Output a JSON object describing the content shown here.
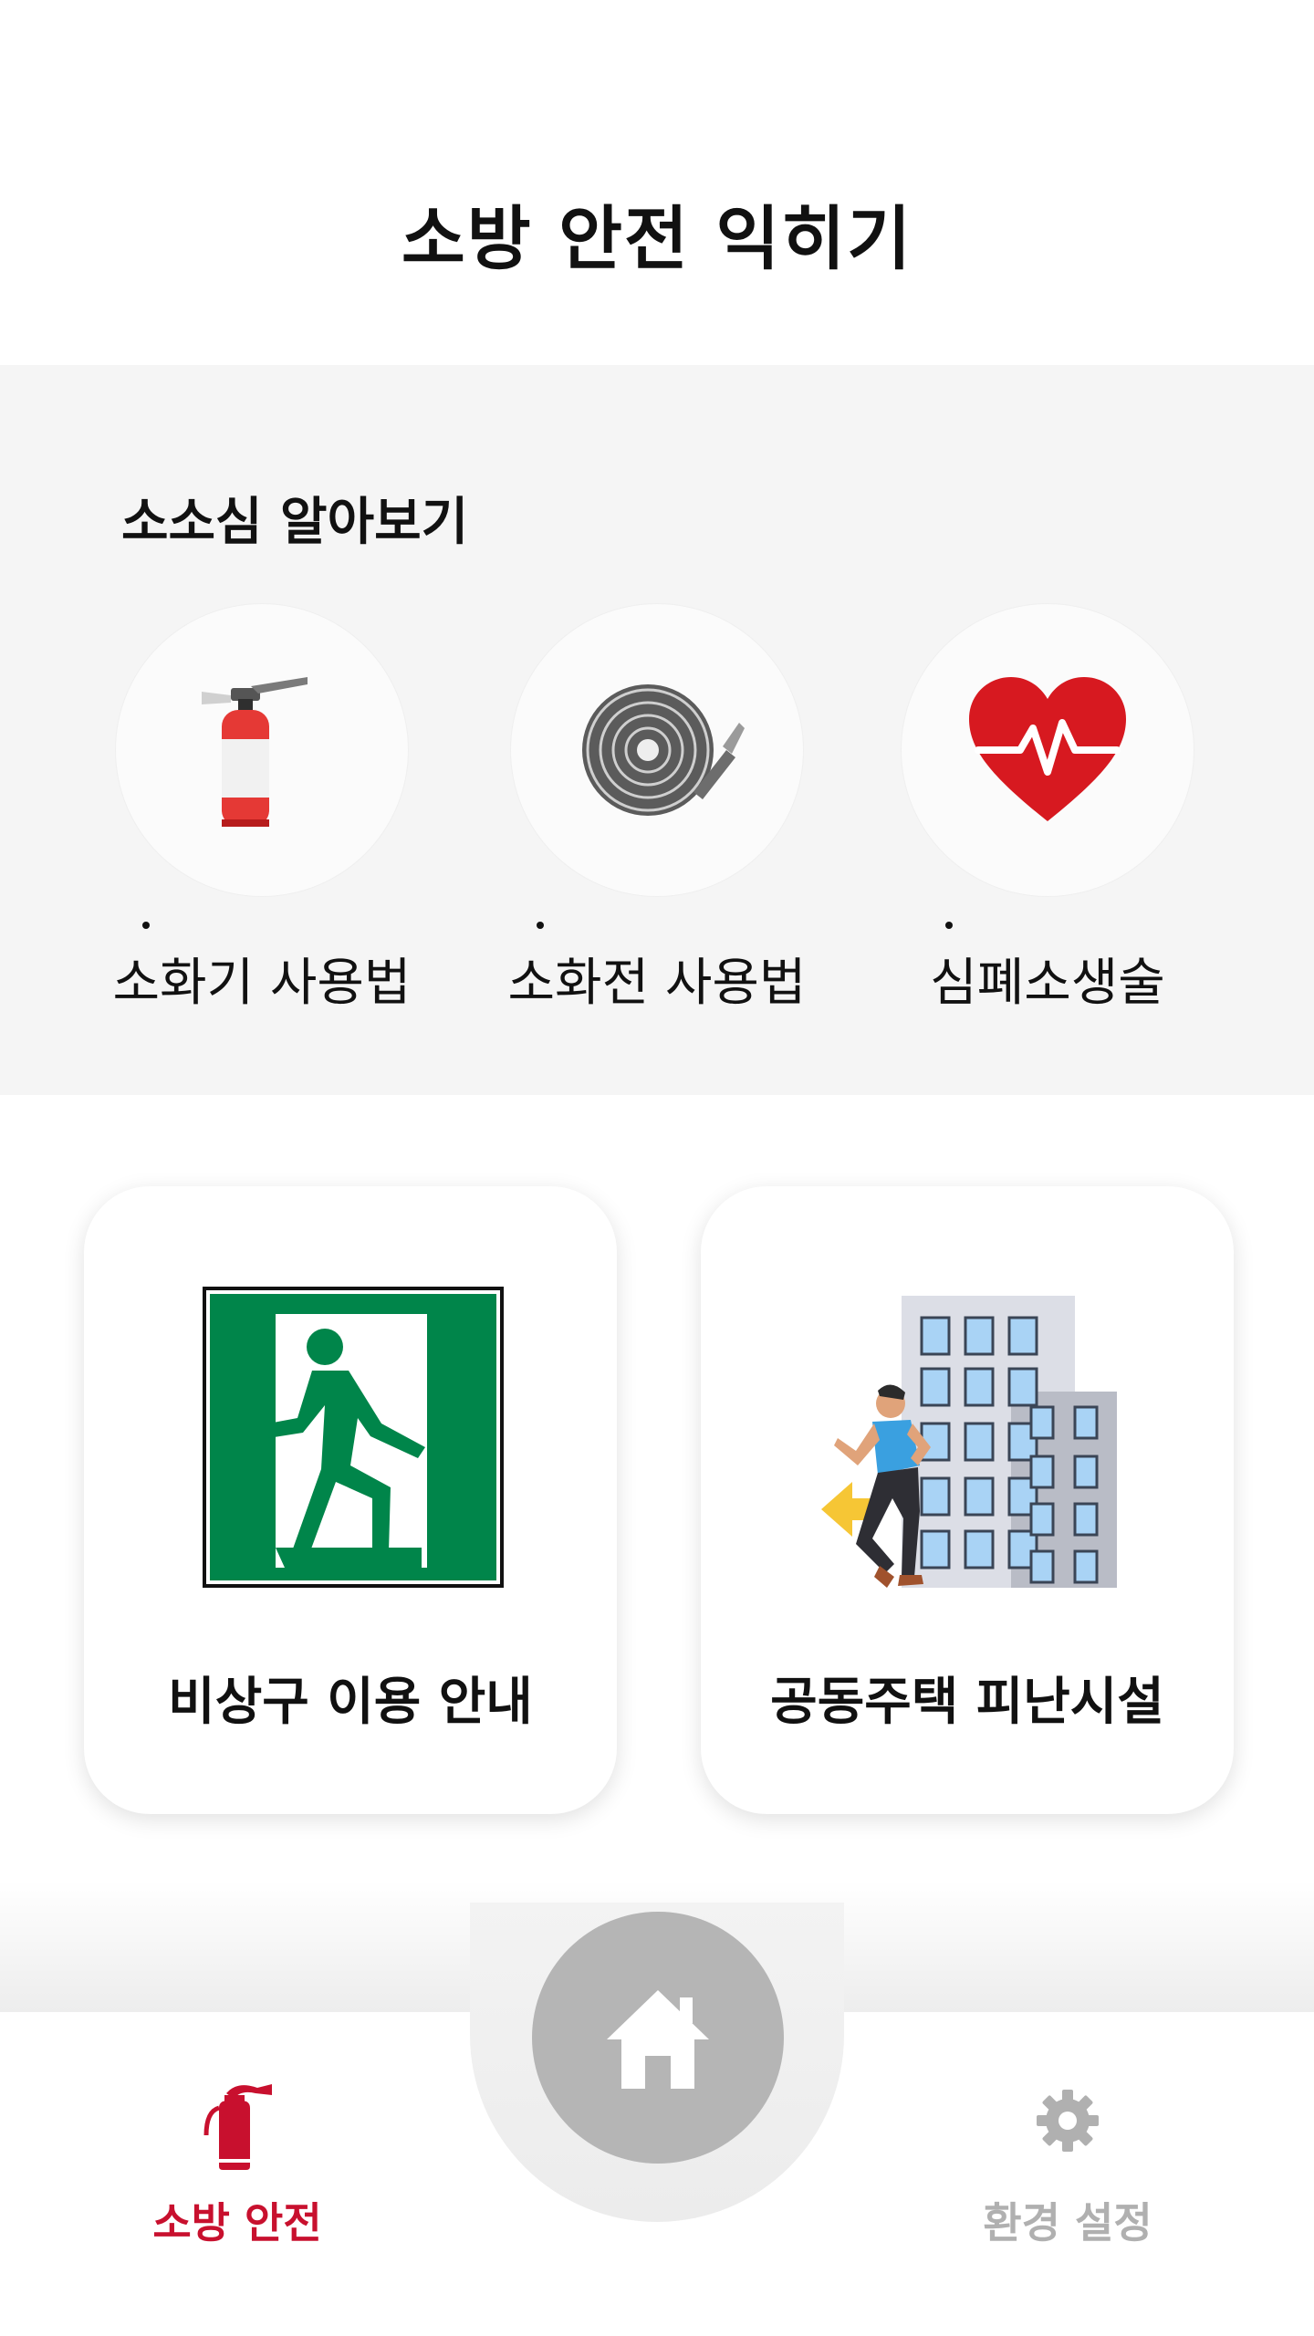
{
  "page": {
    "title": "소방 안전 익히기"
  },
  "section": {
    "title": "소소심 알아보기"
  },
  "tools": [
    {
      "label": "소화기 사용법",
      "icon": "fire-extinguisher-icon"
    },
    {
      "label": "소화전 사용법",
      "icon": "fire-hose-icon"
    },
    {
      "label": "심폐소생술",
      "icon": "heart-pulse-icon"
    }
  ],
  "cards": [
    {
      "label": "비상구 이용 안내",
      "icon": "emergency-exit-icon"
    },
    {
      "label": "공동주택 피난시설",
      "icon": "building-evacuation-icon"
    }
  ],
  "nav": {
    "left": {
      "label": "소방 안전",
      "icon": "fire-extinguisher-icon",
      "active": true,
      "color": "#c8102e"
    },
    "center": {
      "icon": "home-icon"
    },
    "right": {
      "label": "환경 설정",
      "icon": "gear-icon",
      "active": false,
      "color": "#b0b0b0"
    }
  },
  "colors": {
    "accent": "#c8102e",
    "exit_green": "#00854a",
    "panel_bg": "#f5f5f5"
  }
}
